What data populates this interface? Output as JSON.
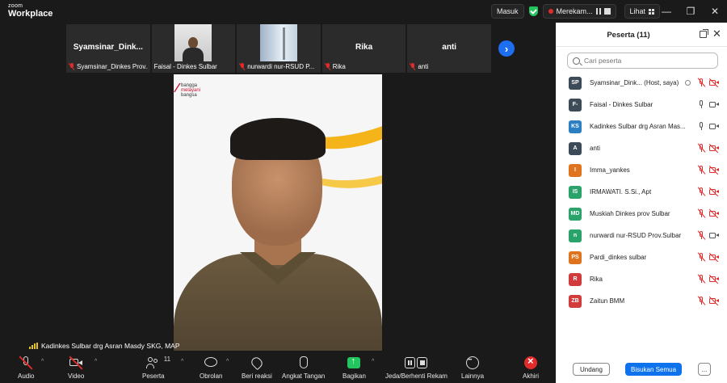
{
  "app": {
    "brand_top": "zoom",
    "brand_bottom": "Workplace"
  },
  "titlebar": {
    "signin_label": "Masuk",
    "recording_label": "Merekam...",
    "view_label": "Lihat",
    "accent_green": "#23c55e",
    "record_red": "#e02b2b"
  },
  "strip": {
    "tiles": [
      {
        "big": "Syamsinar_Dink...",
        "caption": "Syamsinar_Dinkes Prov...",
        "muted": true
      },
      {
        "big": "",
        "caption": "Faisal - Dinkes Sulbar",
        "muted": false
      },
      {
        "big": "",
        "caption": "nurwardi nur-RSUD P...",
        "muted": true
      },
      {
        "big": "Rika",
        "caption": "Rika",
        "muted": true
      },
      {
        "big": "anti",
        "caption": "anti",
        "muted": true
      }
    ]
  },
  "main_video": {
    "speaker_name": "Kadinkes Sulbar drg Asran Masdy SKG, MAP",
    "logo_line1": "bangga",
    "logo_line2": "melayani",
    "logo_line3": "bangsa"
  },
  "toolbar": {
    "audio": "Audio",
    "video": "Video",
    "participants": "Peserta",
    "participants_count": "11",
    "chat": "Obrolan",
    "reactions": "Beri reaksi",
    "raise_hand": "Angkat Tangan",
    "share": "Bagikan",
    "record": "Jeda/Berhenti Rekam",
    "more": "Lainnya",
    "end": "Akhiri"
  },
  "panel": {
    "title": "Peserta (11)",
    "search_placeholder": "Cari peserta",
    "participants": [
      {
        "initials": "SP",
        "name": "Syamsinar_Dink...",
        "role": "(Host, saya)",
        "color": "#3d4a57",
        "mic_off": true,
        "video_off": true
      },
      {
        "initials": "F-",
        "name": "Faisal - Dinkes Sulbar",
        "role": "",
        "color": "#3d4a57",
        "mic_off": false,
        "video_off": false
      },
      {
        "initials": "KS",
        "name": "Kadinkes Sulbar drg Asran Mas...",
        "role": "",
        "color": "#2b7fc2",
        "mic_off": false,
        "video_off": false
      },
      {
        "initials": "A",
        "name": "anti",
        "role": "",
        "color": "#3d4a57",
        "mic_off": true,
        "video_off": true
      },
      {
        "initials": "I",
        "name": "Imma_yankes",
        "role": "",
        "color": "#e0731d",
        "mic_off": true,
        "video_off": true
      },
      {
        "initials": "IS",
        "name": "IRMAWATI. S.Si., Apt",
        "role": "",
        "color": "#2aa36b",
        "mic_off": true,
        "video_off": true
      },
      {
        "initials": "MD",
        "name": "Muskiah Dinkes prov Sulbar",
        "role": "",
        "color": "#2aa36b",
        "mic_off": true,
        "video_off": true
      },
      {
        "initials": "n",
        "name": "nurwardi nur-RSUD Prov.Sulbar",
        "role": "",
        "color": "#2aa36b",
        "mic_off": true,
        "video_off": false
      },
      {
        "initials": "PS",
        "name": "Pardi_dinkes sulbar",
        "role": "",
        "color": "#e0731d",
        "mic_off": true,
        "video_off": true
      },
      {
        "initials": "R",
        "name": "Rika",
        "role": "",
        "color": "#d23b3b",
        "mic_off": true,
        "video_off": true
      },
      {
        "initials": "ZB",
        "name": "Zaitun BMM",
        "role": "",
        "color": "#d23b3b",
        "mic_off": true,
        "video_off": true
      }
    ],
    "invite_label": "Undang",
    "mute_all_label": "Bisukan Semua",
    "more_label": "..."
  }
}
